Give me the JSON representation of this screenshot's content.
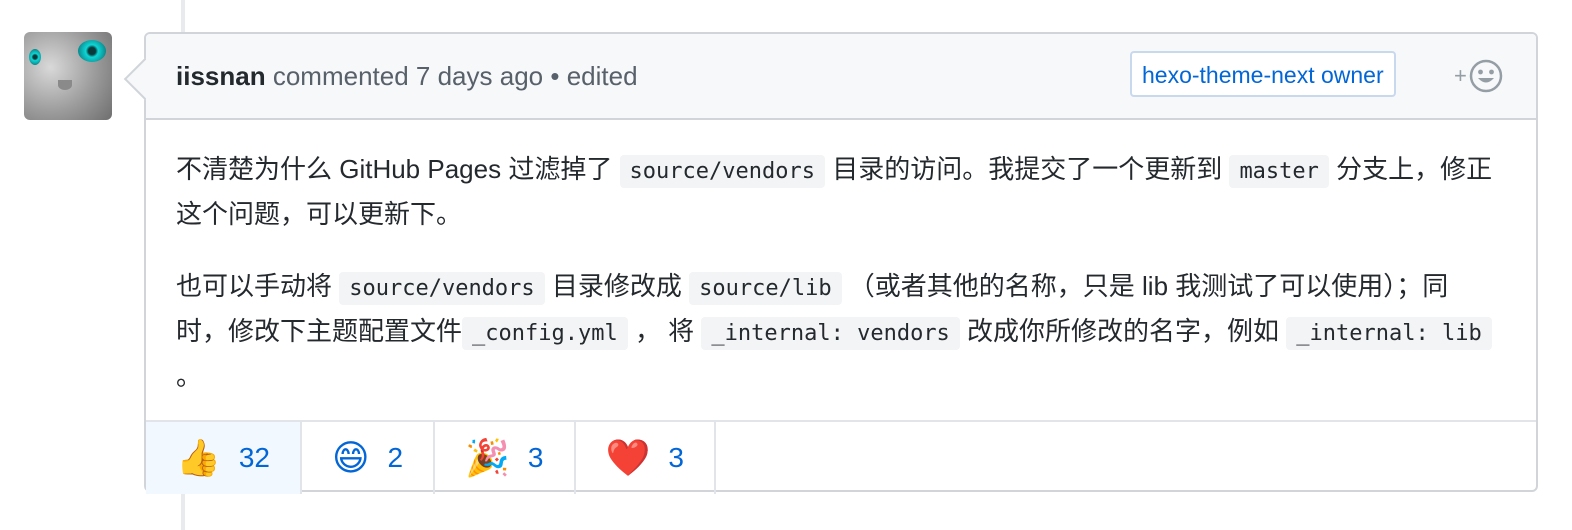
{
  "comment": {
    "author": "iissnan",
    "action": "commented",
    "time": "7 days ago",
    "separator": "•",
    "edited": "edited",
    "badge": "hexo-theme-next owner"
  },
  "body": {
    "p1": {
      "t1": "不清楚为什么 GitHub Pages 过滤掉了 ",
      "c1": "source/vendors",
      "t2": " 目录的访问。我提交了一个更新到 ",
      "c2": "master",
      "t3": " 分支上，修正这个问题，可以更新下。"
    },
    "p2": {
      "t1": "也可以手动将 ",
      "c1": "source/vendors",
      "t2": " 目录修改成 ",
      "c2": "source/lib",
      "t3": " （或者其他的名称，只是 lib 我测试了可以使用）；同时，修改下主题配置文件",
      "c3": "_config.yml",
      "t4": " ， 将 ",
      "c4": "_internal: vendors",
      "t5": " 改成你所修改的名字，例如 ",
      "c5": "_internal: lib",
      "t6": " 。"
    }
  },
  "reactions": [
    {
      "icon": "thumbs-up-icon",
      "emoji": "👍",
      "count": "32"
    },
    {
      "icon": "laugh-icon",
      "emoji": "😄",
      "count": "2"
    },
    {
      "icon": "hooray-icon",
      "emoji": "🎉",
      "count": "3"
    },
    {
      "icon": "heart-icon",
      "emoji": "❤️",
      "count": "3"
    }
  ],
  "add_reaction": {
    "plus": "+"
  }
}
